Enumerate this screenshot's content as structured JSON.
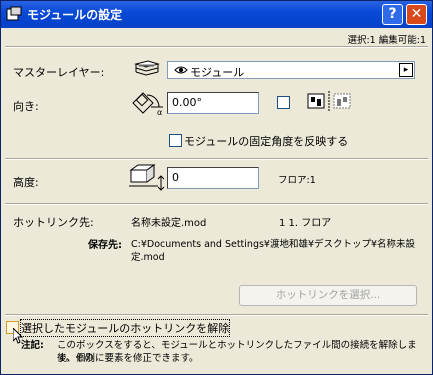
{
  "window": {
    "title": "モジュールの設定",
    "help_label": "?",
    "close_label": "✕"
  },
  "status": "選択:1 編集可能:1",
  "master_layer": {
    "label": "マスターレイヤー:",
    "value": "モジュール"
  },
  "orientation": {
    "label": "向き:",
    "angle_value": "0.00°",
    "fixed_angle_checkbox_label": "モジュールの固定角度を反映する"
  },
  "elevation": {
    "label": "高度:",
    "value": "0",
    "floor_label": "フロア:1"
  },
  "hotlink": {
    "label": "ホットリンク先:",
    "file_name": "名称未設定.mod",
    "floor_info": "1 1. フロア",
    "save_label": "保存先:",
    "save_path_line1": "C:¥Documents and Settings¥渡地和雄¥デスクトップ¥名称未設",
    "save_path_line2": "定.mod",
    "select_button_label": "ホットリンクを選択..."
  },
  "break_link": {
    "checkbox_label": "選択したモジュールのホットリンクを解除",
    "note_label": "注記:",
    "note_line1": "このボックスをすると、モジュールとホットリンクしたファイル間の接続を解除します。その",
    "note_line2": "後、個別に要素を修正できます。"
  },
  "icons": {
    "app": "dialog-settings-icon",
    "layers": "layers-stack-icon",
    "eye": "eye-icon",
    "rotate": "rotation-angle-icon",
    "mirror": "mirror-icon",
    "elevation": "elevation-box-icon"
  }
}
